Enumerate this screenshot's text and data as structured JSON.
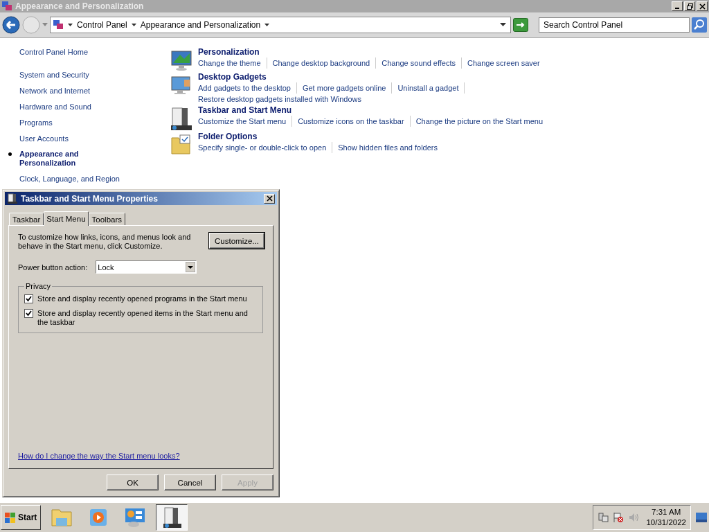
{
  "window": {
    "title": "Appearance and Personalization"
  },
  "address": {
    "crumbs": [
      "Control Panel",
      "Appearance and Personalization"
    ],
    "search_placeholder": "Search Control Panel"
  },
  "sidebar": {
    "home": "Control Panel Home",
    "items": [
      {
        "label": "System and Security",
        "selected": false
      },
      {
        "label": "Network and Internet",
        "selected": false
      },
      {
        "label": "Hardware and Sound",
        "selected": false
      },
      {
        "label": "Programs",
        "selected": false
      },
      {
        "label": "User Accounts",
        "selected": false
      },
      {
        "label": "Appearance and Personalization",
        "selected": true
      },
      {
        "label": "Clock, Language, and Region",
        "selected": false
      }
    ]
  },
  "categories": [
    {
      "kind": "monitor",
      "title": "Personalization",
      "links": [
        "Change the theme",
        "Change desktop background",
        "Change sound effects",
        "Change screen saver"
      ]
    },
    {
      "kind": "gadgets",
      "title": "Desktop Gadgets",
      "links": [
        "Add gadgets to the desktop",
        "Get more gadgets online",
        "Uninstall a gadget",
        "Restore desktop gadgets installed with Windows"
      ]
    },
    {
      "kind": "taskbar",
      "title": "Taskbar and Start Menu",
      "links": [
        "Customize the Start menu",
        "Customize icons on the taskbar",
        "Change the picture on the Start menu"
      ]
    },
    {
      "kind": "folder",
      "title": "Folder Options",
      "links": [
        "Specify single- or double-click to open",
        "Show hidden files and folders"
      ]
    }
  ],
  "dialog": {
    "title": "Taskbar and Start Menu Properties",
    "tabs": [
      {
        "label": "Taskbar",
        "selected": false
      },
      {
        "label": "Start Menu",
        "selected": true
      },
      {
        "label": "Toolbars",
        "selected": false
      }
    ],
    "intro": "To customize how links, icons, and menus look and behave in the Start menu, click Customize.",
    "customize_button": "Customize...",
    "power_label": "Power button action:",
    "power_value": "Lock",
    "privacy": {
      "title": "Privacy",
      "options": [
        {
          "label": "Store and display recently opened programs in the Start menu",
          "checked": true
        },
        {
          "label": "Store and display recently opened items in the Start menu and the taskbar",
          "checked": true
        }
      ]
    },
    "help_link": "How do I change the way the Start menu looks?",
    "buttons": [
      {
        "label": "OK",
        "disabled": false
      },
      {
        "label": "Cancel",
        "disabled": false
      },
      {
        "label": "Apply",
        "disabled": true
      }
    ]
  },
  "taskbar": {
    "start": "Start",
    "apps": [
      {
        "kind": "explorer",
        "selected": false
      },
      {
        "kind": "media",
        "selected": false
      },
      {
        "kind": "control",
        "selected": false
      },
      {
        "kind": "taskbar",
        "selected": true
      }
    ],
    "time": "7:31 AM",
    "date": "10/31/2022"
  }
}
